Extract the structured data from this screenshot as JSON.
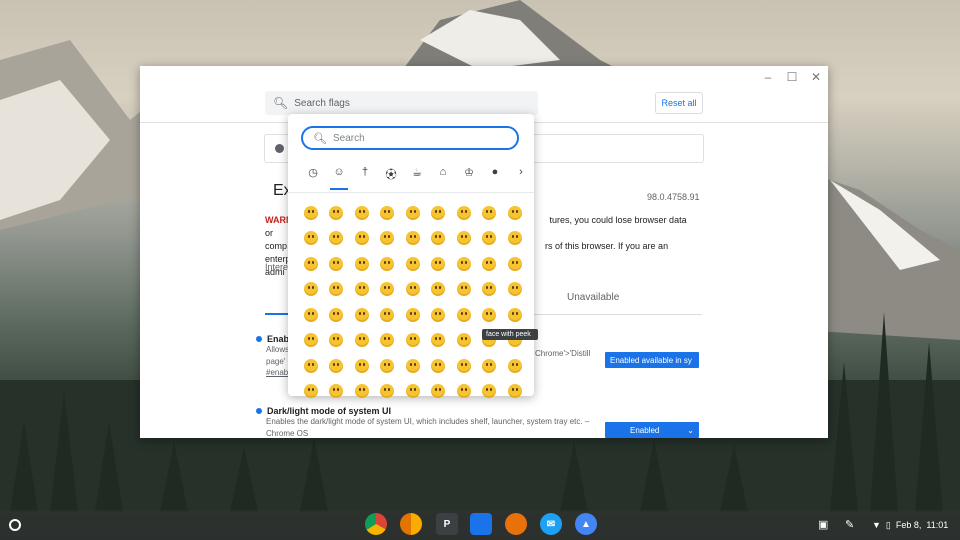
{
  "flags_page": {
    "search_placeholder": "Search flags",
    "reset_label": "Reset all",
    "title": "Ex",
    "version": "98.0.4758.91",
    "warning_label": "WARN",
    "warning_line1_start": "comp",
    "warning_line2_start": "admi",
    "warning_line1_end": "tures, you could lose browser data or",
    "warning_line2_end": "rs of this browser. If you are an enterprise",
    "interest_label": "Intere",
    "tab_unavailable": "Unavailable",
    "flag1": {
      "title": "Enable",
      "desc": "Allows",
      "desc2": "page'",
      "link": "#enab",
      "desc_right": "Chrome'>'Distill",
      "select_value": "Enabled available in sy"
    },
    "flag2": {
      "title": "Dark/light mode of system UI",
      "desc": "Enables the dark/light mode of system UI, which includes shelf, launcher, system tray etc. –",
      "desc2": "Chrome OS",
      "select_value": "Enabled"
    }
  },
  "window_controls": {
    "minimize": "–",
    "maximize": "☐",
    "close": "✕"
  },
  "emoji_picker": {
    "search_placeholder": "Search",
    "categories": [
      "recent-icon",
      "smiley-icon",
      "person-icon",
      "activity-icon",
      "food-icon",
      "travel-icon",
      "trophy-icon",
      "lightbulb-icon",
      "chevron-right-icon"
    ],
    "tooltip": "face with peek",
    "accent": "#1a73e8"
  },
  "shelf": {
    "apps": [
      "chrome",
      "chrome-canary",
      "p-app",
      "files",
      "app-5",
      "twitter",
      "lab-app"
    ],
    "date": "Feb 8,",
    "time": "11:01"
  }
}
